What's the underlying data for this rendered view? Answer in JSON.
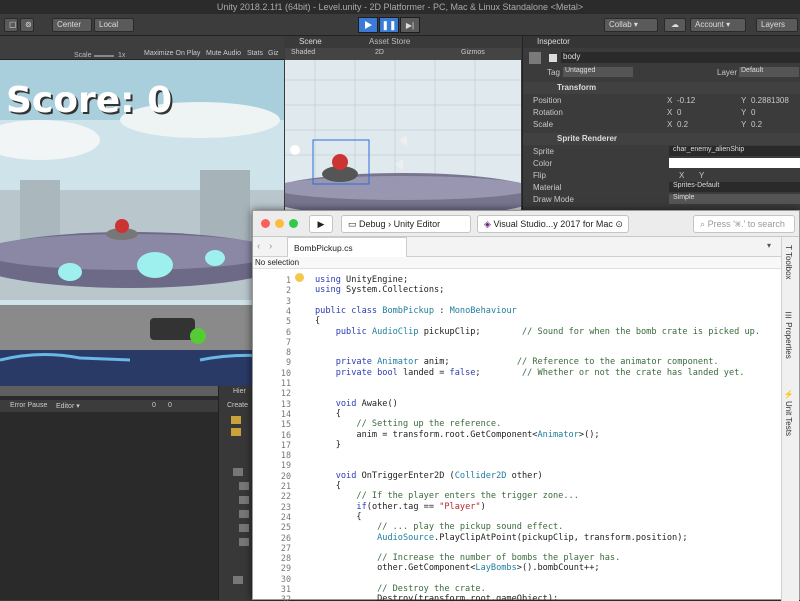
{
  "window": {
    "title": "Unity 2018.2.1f1 (64bit) - Level.unity - 2D Platformer - PC, Mac & Linux Standalone <Metal>"
  },
  "toolbar": {
    "center": "Center",
    "local": "Local",
    "collab": "Collab ▾",
    "account": "Account",
    "layers": "Layers"
  },
  "game": {
    "scale_label": "Scale",
    "scale_value": "1x",
    "maximize": "Maximize On Play",
    "mute": "Mute Audio",
    "stats": "Stats",
    "gizmos": "Giz",
    "score": "Score: 0"
  },
  "scene": {
    "tab": "Scene",
    "asset_store_tab": "Asset Store",
    "shaded": "Shaded",
    "mode_2d": "2D",
    "gizmos": "Gizmos"
  },
  "inspector": {
    "tab": "Inspector",
    "object_name": "body",
    "tag_label": "Tag",
    "tag_value": "Untagged",
    "layer_label": "Layer",
    "layer_value": "Default",
    "transform": "Transform",
    "position_label": "Position",
    "pos_x": "-0.12",
    "pos_y": "0.2881308",
    "rotation_label": "Rotation",
    "rot_x": "0",
    "rot_y": "0",
    "scale_label": "Scale",
    "scale_x": "0.2",
    "scale_y": "0.2",
    "sprite_renderer": "Sprite Renderer",
    "sprite_label": "Sprite",
    "sprite_value": "char_enemy_alienShip",
    "color_label": "Color",
    "flip_label": "Flip",
    "flip_x": "X",
    "flip_y": "Y",
    "material_label": "Material",
    "material_value": "Sprites-Default",
    "draw_mode_label": "Draw Mode",
    "draw_mode_value": "Simple",
    "x": "X",
    "y": "Y"
  },
  "console": {
    "error_pause": "Error Pause",
    "editor": "Editor ▾",
    "err_count": "0",
    "warn_count": "0"
  },
  "hierarchy": {
    "tab": "Hier",
    "create": "Create"
  },
  "vs": {
    "config": "Debug",
    "target": "Unity Editor",
    "tool": "Visual Studio...y 2017 for Mac",
    "search_placeholder": "Press '⌘.' to search",
    "file_tab": "BombPickup.cs",
    "no_selection": "No selection",
    "side_toolbox": "Toolbox",
    "side_properties": "Properties",
    "side_tests": "Unit Tests",
    "lines": [
      {
        "n": "1",
        "html": "<span class='kw'>using</span> UnityEngine;"
      },
      {
        "n": "2",
        "html": "<span class='kw'>using</span> System.Collections;"
      },
      {
        "n": "3",
        "html": ""
      },
      {
        "n": "4",
        "html": "<span class='kw'>public class</span> <span class='ty'>BombPickup</span> : <span class='ty'>MonoBehaviour</span>"
      },
      {
        "n": "5",
        "html": "{"
      },
      {
        "n": "6",
        "html": "    <span class='kw'>public</span> <span class='ty'>AudioClip</span> pickupClip;        <span class='cm'>// Sound for when the bomb crate is picked up.</span>"
      },
      {
        "n": "7",
        "html": ""
      },
      {
        "n": "8",
        "html": ""
      },
      {
        "n": "9",
        "html": "    <span class='kw'>private</span> <span class='ty'>Animator</span> anim;             <span class='cm'>// Reference to the animator component.</span>"
      },
      {
        "n": "10",
        "html": "    <span class='kw'>private bool</span> landed = <span class='kw'>false</span>;        <span class='cm'>// Whether or not the crate has landed yet.</span>"
      },
      {
        "n": "11",
        "html": ""
      },
      {
        "n": "12",
        "html": ""
      },
      {
        "n": "13",
        "html": "    <span class='kw'>void</span> Awake()"
      },
      {
        "n": "14",
        "html": "    {"
      },
      {
        "n": "15",
        "html": "        <span class='cm'>// Setting up the reference.</span>"
      },
      {
        "n": "16",
        "html": "        anim = transform.root.GetComponent&lt;<span class='ty'>Animator</span>&gt;();"
      },
      {
        "n": "17",
        "html": "    }"
      },
      {
        "n": "18",
        "html": ""
      },
      {
        "n": "19",
        "html": ""
      },
      {
        "n": "20",
        "html": "    <span class='kw'>void</span> OnTriggerEnter2D (<span class='ty'>Collider2D</span> other)"
      },
      {
        "n": "21",
        "html": "    {"
      },
      {
        "n": "22",
        "html": "        <span class='cm'>// If the player enters the trigger zone...</span>"
      },
      {
        "n": "23",
        "html": "        <span class='kw'>if</span>(other.tag == <span class='st'>\"Player\"</span>)"
      },
      {
        "n": "24",
        "html": "        {"
      },
      {
        "n": "25",
        "html": "            <span class='cm'>// ... play the pickup sound effect.</span>"
      },
      {
        "n": "26",
        "html": "            <span class='ty'>AudioSource</span>.PlayClipAtPoint(pickupClip, transform.position);"
      },
      {
        "n": "27",
        "html": ""
      },
      {
        "n": "28",
        "html": "            <span class='cm'>// Increase the number of bombs the player has.</span>"
      },
      {
        "n": "29",
        "html": "            other.GetComponent&lt;<span class='ty'>LayBombs</span>&gt;().bombCount++;"
      },
      {
        "n": "30",
        "html": ""
      },
      {
        "n": "31",
        "html": "            <span class='cm'>// Destroy the crate.</span>"
      },
      {
        "n": "32",
        "html": "            Destroy(transform.root.gameObject);"
      }
    ]
  }
}
